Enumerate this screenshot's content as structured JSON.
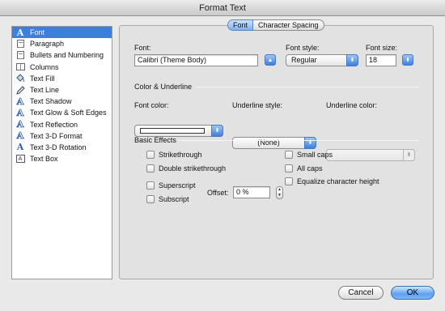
{
  "window": {
    "title": "Format Text"
  },
  "sidebar": {
    "items": [
      {
        "label": "Font",
        "icon": "font-a-icon",
        "selected": true
      },
      {
        "label": "Paragraph",
        "icon": "paragraph-icon"
      },
      {
        "label": "Bullets and Numbering",
        "icon": "bullets-icon"
      },
      {
        "label": "Columns",
        "icon": "columns-icon"
      },
      {
        "label": "Text Fill",
        "icon": "paint-bucket-icon"
      },
      {
        "label": "Text Line",
        "icon": "pen-icon"
      },
      {
        "label": "Text Shadow",
        "icon": "shadow-a-icon"
      },
      {
        "label": "Text Glow & Soft Edges",
        "icon": "glow-a-icon"
      },
      {
        "label": "Text Reflection",
        "icon": "reflection-a-icon"
      },
      {
        "label": "Text 3-D Format",
        "icon": "3d-format-a-icon"
      },
      {
        "label": "Text 3-D Rotation",
        "icon": "3d-rotation-icon"
      },
      {
        "label": "Text Box",
        "icon": "text-box-icon"
      }
    ]
  },
  "tabs": [
    {
      "label": "Font",
      "active": true
    },
    {
      "label": "Character Spacing",
      "active": false
    }
  ],
  "font_section": {
    "font_label": "Font:",
    "font_value": "Calibri (Theme Body)",
    "style_label": "Font style:",
    "style_value": "Regular",
    "size_label": "Font size:",
    "size_value": "18"
  },
  "color_section": {
    "title": "Color & Underline",
    "font_color_label": "Font color:",
    "font_color": "#ffffff",
    "underline_style_label": "Underline style:",
    "underline_style_value": "(None)",
    "underline_color_label": "Underline color:",
    "underline_color_value": ""
  },
  "effects_section": {
    "title": "Basic Effects",
    "strikethrough": "Strikethrough",
    "double_strikethrough": "Double strikethrough",
    "superscript": "Superscript",
    "subscript": "Subscript",
    "offset_label": "Offset:",
    "offset_value": "0 %",
    "small_caps": "Small caps",
    "all_caps": "All caps",
    "equalize": "Equalize character height"
  },
  "buttons": {
    "cancel": "Cancel",
    "ok": "OK"
  },
  "colors": {
    "accent": "#3d7fdc"
  }
}
